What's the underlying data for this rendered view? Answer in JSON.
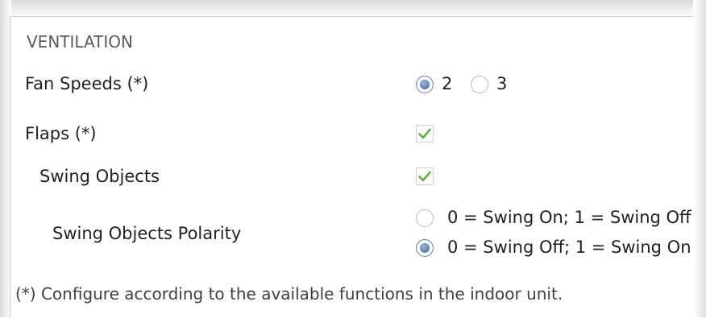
{
  "section": {
    "title": "VENTILATION"
  },
  "fan_speeds": {
    "label": "Fan Speeds (*)",
    "options": [
      {
        "label": "2",
        "selected": true
      },
      {
        "label": "3",
        "selected": false
      }
    ]
  },
  "flaps": {
    "label": "Flaps (*)",
    "checked": true
  },
  "swing_objects": {
    "label": "Swing Objects",
    "checked": true
  },
  "swing_polarity": {
    "label": "Swing Objects Polarity",
    "options": [
      {
        "label": "0 = Swing On; 1 = Swing Off",
        "selected": false
      },
      {
        "label": "0 = Swing Off; 1 = Swing On",
        "selected": true
      }
    ]
  },
  "footnote": "(*) Configure according to the available functions in the indoor unit.",
  "colors": {
    "accent": "#5b79ad",
    "check": "#6aaa4a",
    "text": "#1f1f1f",
    "muted": "#5a5a5a"
  },
  "icons": {
    "check": "checkmark-icon"
  }
}
